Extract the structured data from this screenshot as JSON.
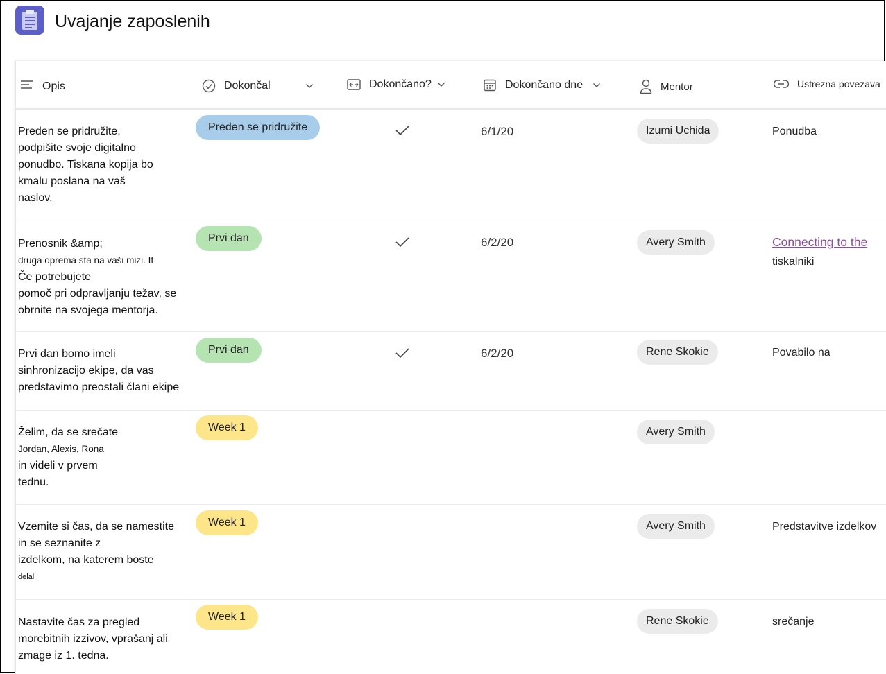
{
  "app": {
    "title": "Uvajanje zaposlenih",
    "icon": "clipboard-icon",
    "accent": "#5b5fc7"
  },
  "columns": [
    {
      "label": "Opis",
      "icon": "lines-icon"
    },
    {
      "label": "Dokončal",
      "icon": "check-circle-icon"
    },
    {
      "label": "Dokončano?",
      "icon": "toggle-icon"
    },
    {
      "label": "Dokončano dne",
      "icon": "calendar-icon"
    },
    {
      "label": "Mentor",
      "icon": "person-icon"
    },
    {
      "label": "Ustrezna povezava",
      "icon": "link-icon"
    }
  ],
  "rows": [
    {
      "description": [
        "Preden se pridružite,",
        "podpišite svoje digitalno",
        "ponudbo. Tiskana kopija bo",
        "kmalu poslana na vaš",
        "naslov."
      ],
      "stage": "Preden se pridružite",
      "stage_color": "#a7cdea",
      "done": true,
      "date": "6/1/20",
      "mentor": "Izumi Uchida",
      "link": [
        "Ponudba"
      ]
    },
    {
      "description": [
        "Prenosnik &amp;",
        "druga oprema sta na vaši mizi.   If",
        "Če potrebujete",
        "pomoč pri odpravljanju težav, se",
        "obrnite na svojega mentorja."
      ],
      "stage": "Prvi dan",
      "stage_color": "#b5e4b2",
      "done": true,
      "date": "6/2/20",
      "mentor": "Avery Smith",
      "link": [
        "Connecting to the",
        "tiskalniki"
      ]
    },
    {
      "description": [
        "Prvi dan bomo imeli",
        "sinhronizacijo ekipe, da vas",
        "predstavimo preostali člani ekipe"
      ],
      "stage": "Prvi dan",
      "stage_color": "#b5e4b2",
      "done": true,
      "date": "6/2/20",
      "mentor": "Rene Skokie",
      "link": [
        "Povabilo na"
      ]
    },
    {
      "description": [
        "Želim, da se srečate",
        "Jordan, Alexis, Rona",
        "in videli v prvem",
        "tednu."
      ],
      "stage": "Week 1",
      "stage_color": "#fde58a",
      "done": false,
      "date": "",
      "mentor": "Avery Smith",
      "link": []
    },
    {
      "description": [
        "Vzemite si čas, da se namestite",
        "in se seznanite z",
        "izdelkom, na katerem boste",
        "delali"
      ],
      "stage": "Week 1",
      "stage_color": "#fde58a",
      "done": false,
      "date": "",
      "mentor": "Avery Smith",
      "link": [
        "Predstavitve izdelkov"
      ]
    },
    {
      "description": [
        "Nastavite čas za pregled",
        "morebitnih izzivov, vprašanj ali",
        "zmage iz 1. tedna."
      ],
      "stage": "Week 1",
      "stage_color": "#fde58a",
      "done": false,
      "date": "",
      "mentor": "Rene Skokie",
      "link": [
        "srečanje"
      ]
    }
  ]
}
